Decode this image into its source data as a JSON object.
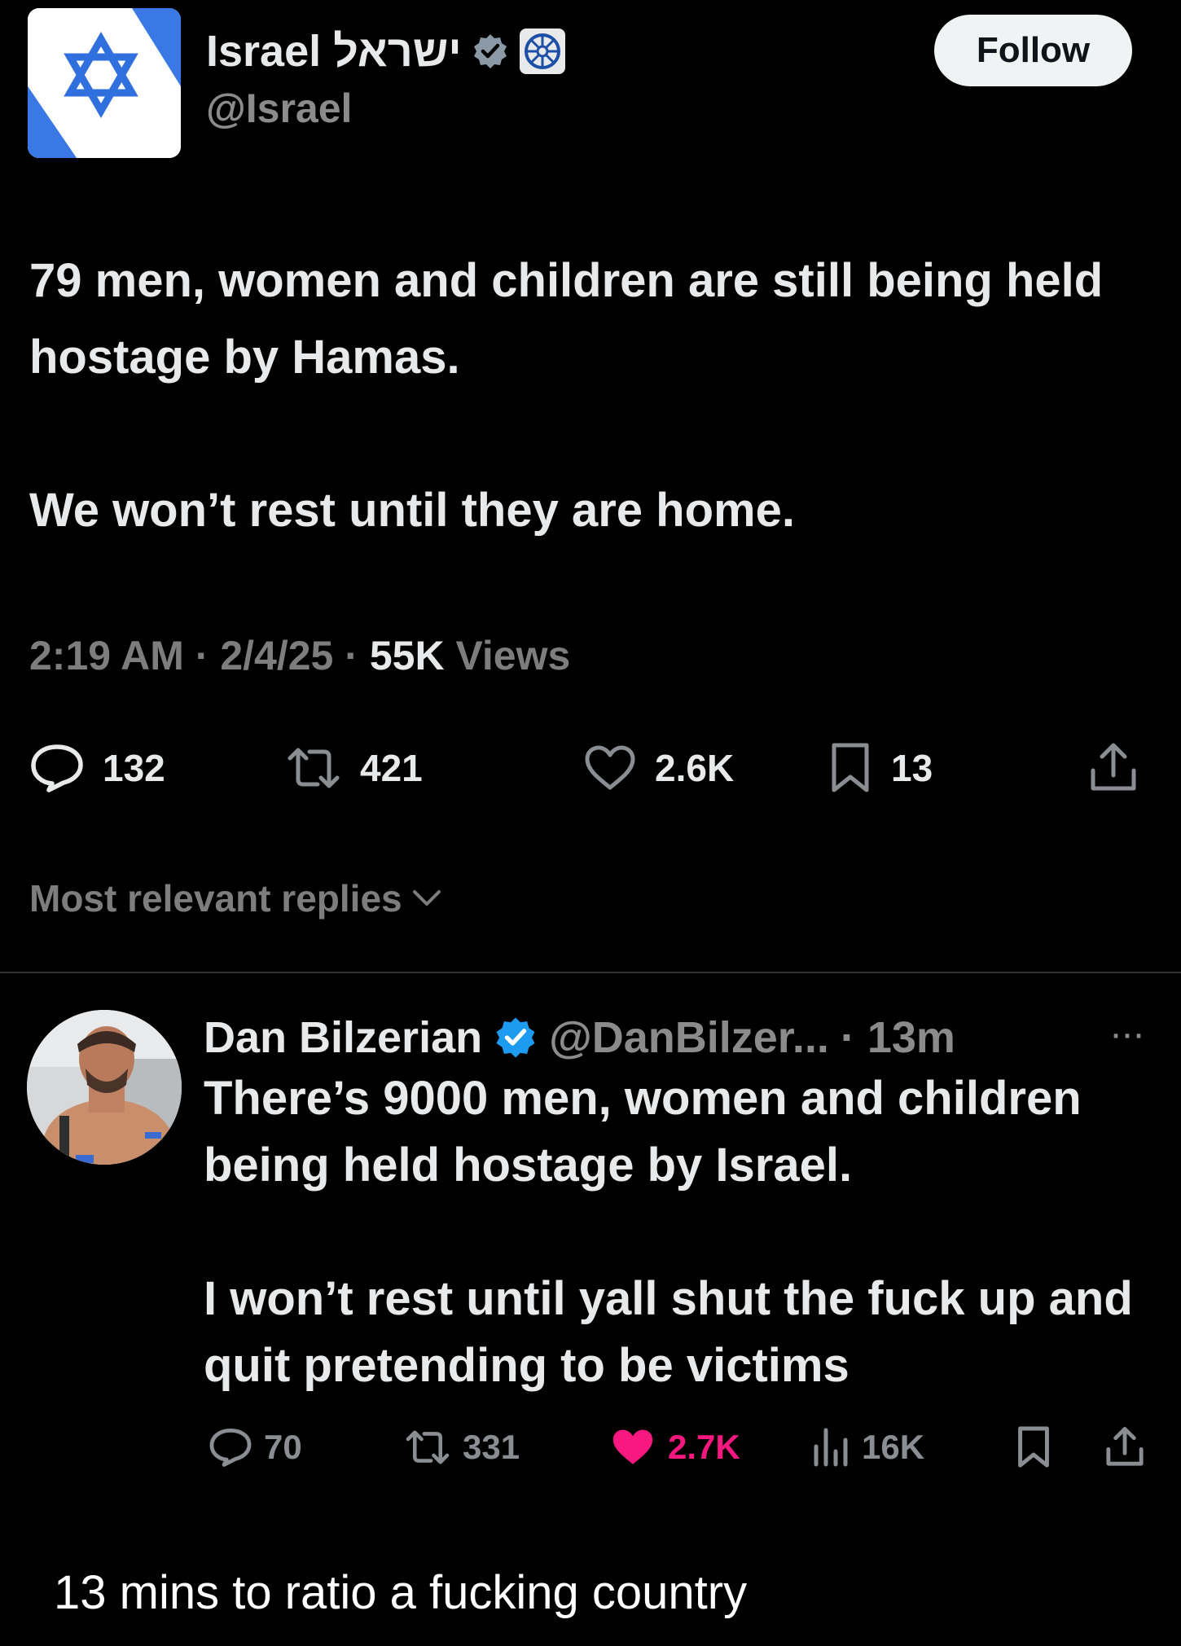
{
  "tweet": {
    "author_name": "Israel ישראל",
    "handle": "@Israel",
    "verified_icon": "gray-verified-badge",
    "affiliate_icon": "government-seal-icon",
    "follow_label": "Follow",
    "text_line1": "79 men, women and children are still being held hostage by Hamas.",
    "text_line2": "We won’t rest until they are home.",
    "time": "2:19 AM",
    "date": "2/4/25",
    "views_count": "55K",
    "views_label": "Views",
    "separator": "·",
    "stats": {
      "replies": "132",
      "retweets": "421",
      "likes": "2.6K",
      "bookmarks": "13"
    }
  },
  "replies_sort": {
    "label": "Most relevant replies"
  },
  "reply": {
    "author_name": "Dan Bilzerian",
    "handle": "@DanBilzer...",
    "time_ago": "· 13m",
    "more": "···",
    "text_line1": "There’s 9000 men, women and children being held hostage by Israel.",
    "text_line2": "I won’t rest until yall shut the fuck up and quit pretending to be victims",
    "stats": {
      "replies": "70",
      "retweets": "331",
      "likes": "2.7K",
      "views": "16K"
    },
    "colors": {
      "like_active": "#f91880",
      "verified": "#1d9bf0"
    }
  },
  "caption": {
    "text": "13 mins to ratio a fucking country"
  }
}
